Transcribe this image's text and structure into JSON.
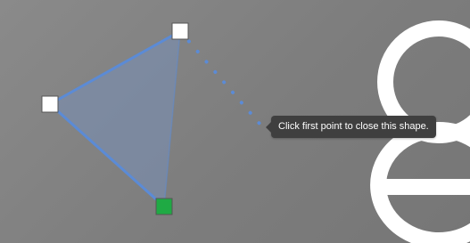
{
  "tooltip": {
    "text": "Click first point to close this shape."
  },
  "colors": {
    "shape_stroke": "#5b8bd6",
    "shape_fill": "#7890b8",
    "vertex_handle": "#ffffff",
    "first_point_handle": "#1faa44",
    "tooltip_bg": "#3f3f3f",
    "background": "#808080",
    "background_glyph": "#ffffff"
  },
  "icons": {
    "vertex": "square-handle",
    "first_point": "square-handle-green"
  }
}
